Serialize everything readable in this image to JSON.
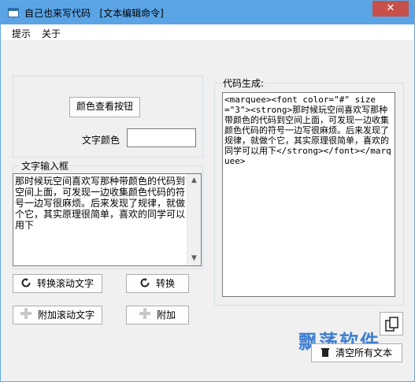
{
  "window": {
    "title": "自己也来写代码   [文本编辑命令]",
    "close_glyph": "✕"
  },
  "menu": {
    "items": [
      "提示",
      "关于"
    ]
  },
  "color_panel": {
    "view_button": "颜色查看按钮",
    "color_label": "文字颜色",
    "color_value": ""
  },
  "text_input": {
    "group_label": "文字输入框",
    "value": "那时候玩空间喜欢写那种带颜色的代码到空间上面，可发现一边收集颜色代码的符号一边写很麻烦。后来发现了规律，就做个它，其实原理很简单，喜欢的同学可以用下"
  },
  "buttons": {
    "convert_scroll": "转换滚动文字",
    "convert": "转换",
    "append_scroll": "附加滚动文字",
    "append": "附加",
    "clear_all": "清空所有文本"
  },
  "code_output": {
    "group_label": "代码生成:",
    "value": "<marquee><font color=\"#\" size=\"3\"><strong>那时候玩空间喜欢写那种带颜色的代码到空间上面，可发现一边收集颜色代码的符号一边写很麻烦。后来发现了规律，就做个它，其实原理很简单，喜欢的同学可以用下</strong></font></marquee>"
  },
  "icons": {
    "refresh": "refresh-icon",
    "plus": "plus-icon",
    "trash": "trash-icon",
    "copy": "copy-icon"
  },
  "watermark": "飘荡软件",
  "colors": {
    "titlebar": "#5aa4e6",
    "close": "#c7514a",
    "watermark": "#3f7fd0"
  }
}
